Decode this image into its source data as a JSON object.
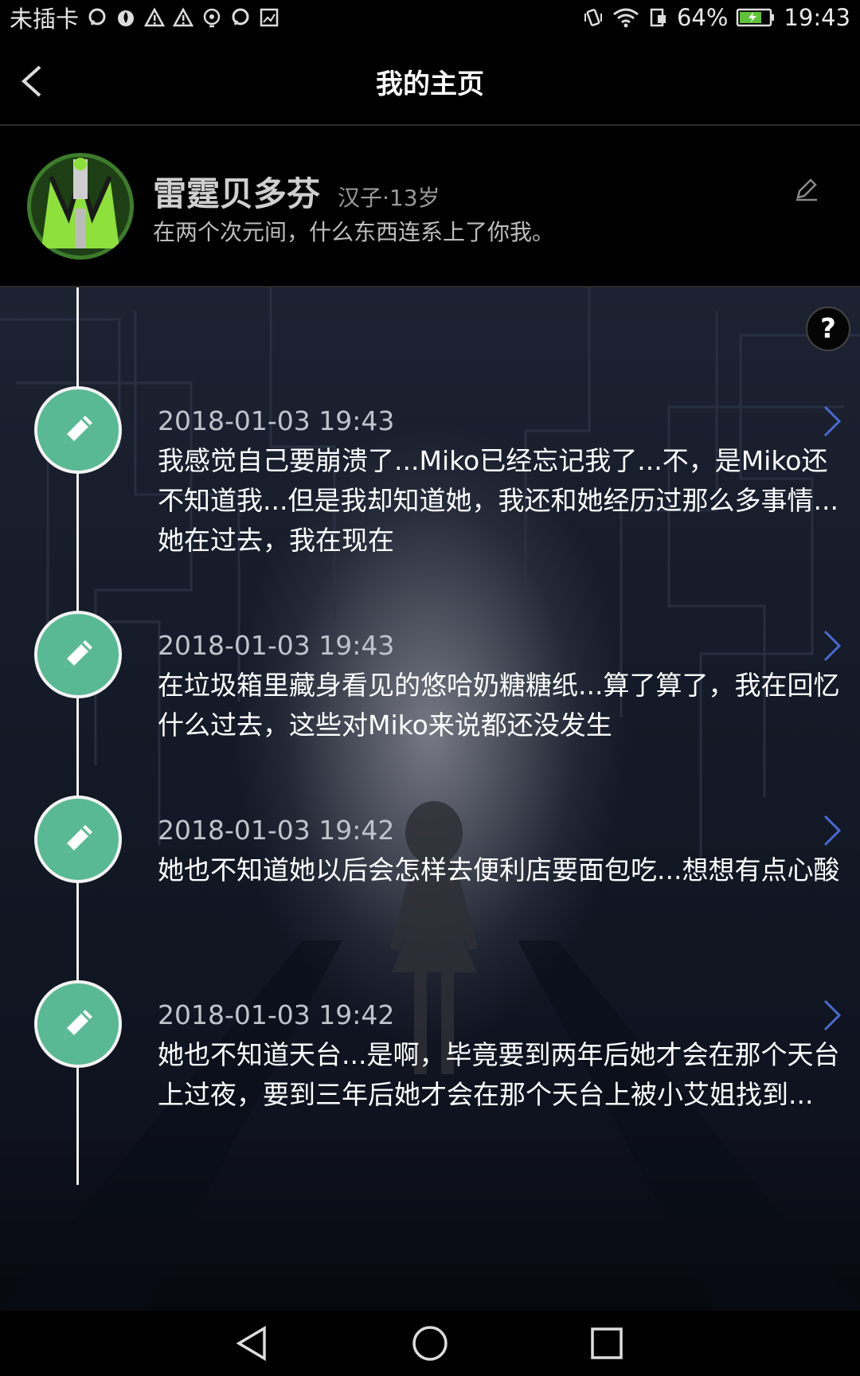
{
  "status_bar": {
    "carrier": "未插卡",
    "battery": "64%",
    "time": "19:43"
  },
  "header": {
    "title": "我的主页"
  },
  "profile": {
    "name": "雷霆贝多芬",
    "meta": "汉子·13岁",
    "signature": "在两个次元间，什么东西连系上了你我。"
  },
  "help_label": "?",
  "entries": [
    {
      "time": "2018-01-03 19:43",
      "text": "我感觉自己要崩溃了...Miko已经忘记我了...不，是Miko还不知道我...但是我却知道她，我还和她经历过那么多事情...她在过去，我在现在"
    },
    {
      "time": "2018-01-03 19:43",
      "text": "在垃圾箱里藏身看见的悠哈奶糖糖纸...算了算了，我在回忆什么过去，这些对Miko来说都还没发生"
    },
    {
      "time": "2018-01-03 19:42",
      "text": "她也不知道她以后会怎样去便利店要面包吃...想想有点心酸"
    },
    {
      "time": "2018-01-03 19:42",
      "text": "她也不知道天台...是啊，毕竟要到两年后她才会在那个天台上过夜，要到三年后她才会在那个天台上被小艾姐找到..."
    }
  ],
  "colors": {
    "node_green": "#59b994",
    "background": "#000000"
  }
}
